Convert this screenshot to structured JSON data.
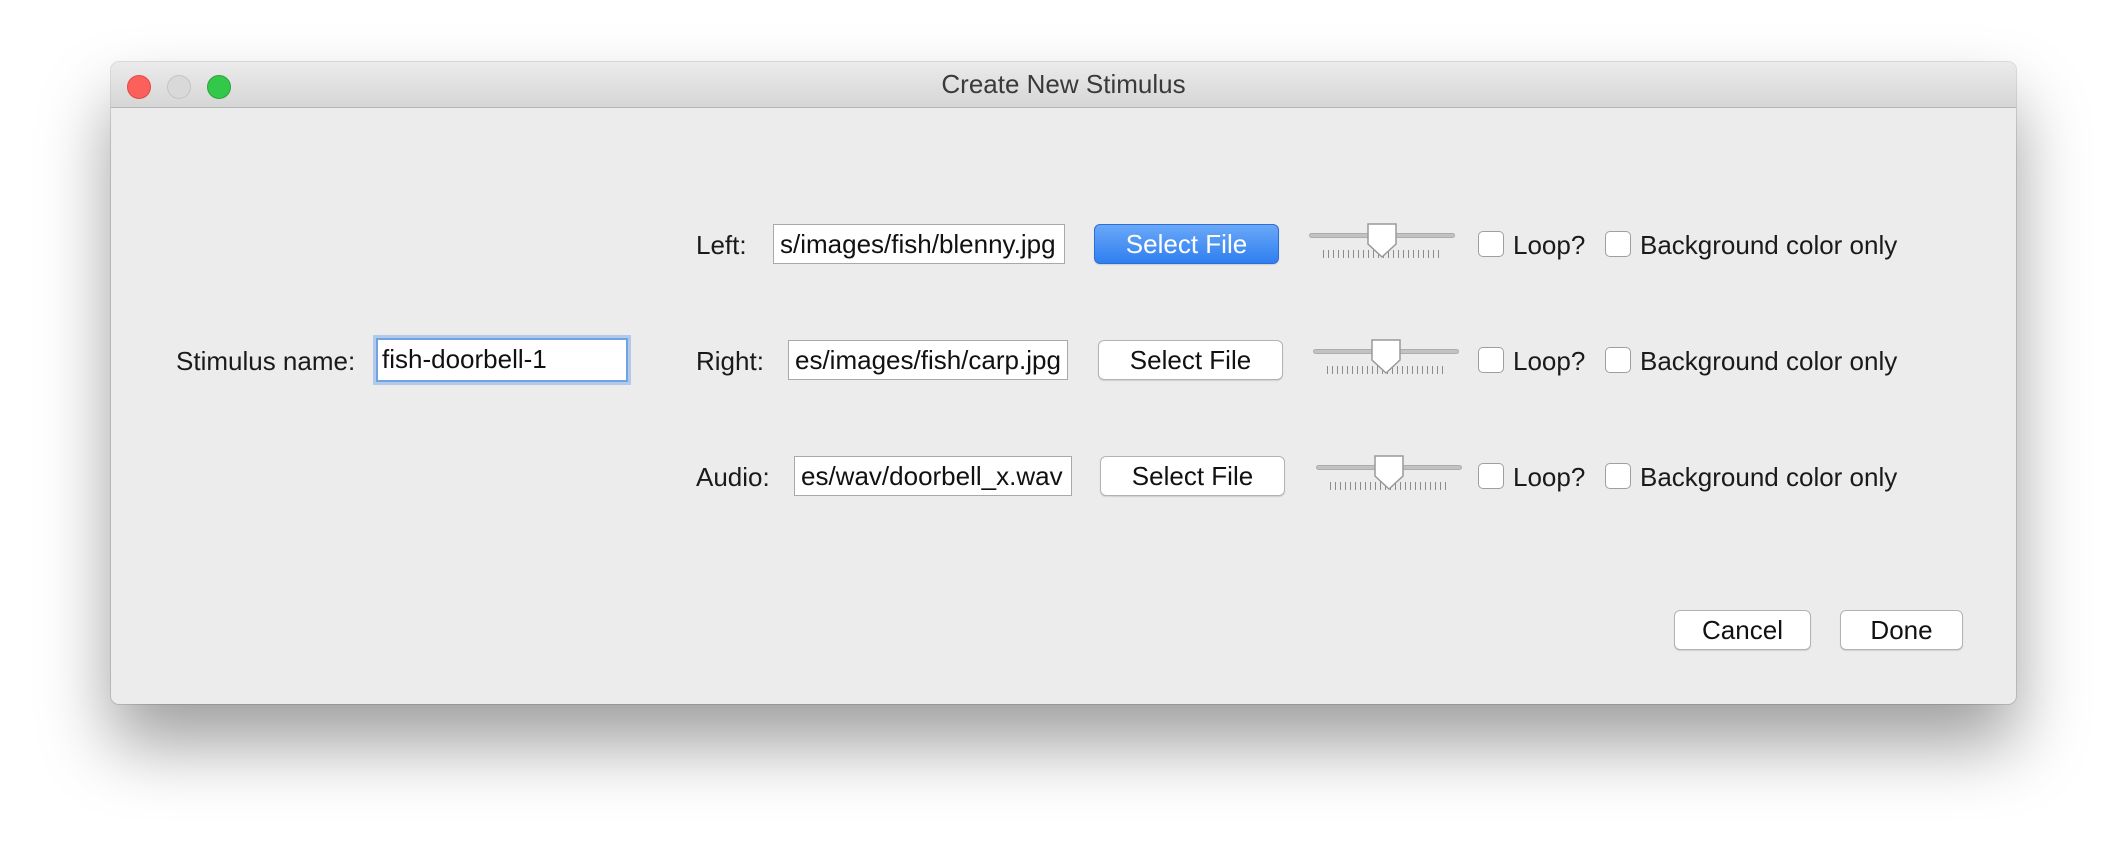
{
  "window": {
    "title": "Create New Stimulus"
  },
  "stimulus": {
    "label": "Stimulus name:",
    "value": "fish-doorbell-1"
  },
  "rows": [
    {
      "label": "Left:",
      "path": "s/images/fish/blenny.jpg",
      "button": "Select File",
      "slider_value": 0.5,
      "loop_label": "Loop?",
      "loop_checked": false,
      "bg_label": "Background color only",
      "bg_checked": false
    },
    {
      "label": "Right:",
      "path": "es/images/fish/carp.jpg",
      "button": "Select File",
      "slider_value": 0.5,
      "loop_label": "Loop?",
      "loop_checked": false,
      "bg_label": "Background color only",
      "bg_checked": false
    },
    {
      "label": "Audio:",
      "path": "es/wav/doorbell_x.wav",
      "button": "Select File",
      "slider_value": 0.5,
      "loop_label": "Loop?",
      "loop_checked": false,
      "bg_label": "Background color only",
      "bg_checked": false
    }
  ],
  "footer": {
    "cancel": "Cancel",
    "done": "Done"
  },
  "colors": {
    "window_bg": "#ececec",
    "accent": "#2f7ff0",
    "focus_ring": "#6fa3e4"
  }
}
